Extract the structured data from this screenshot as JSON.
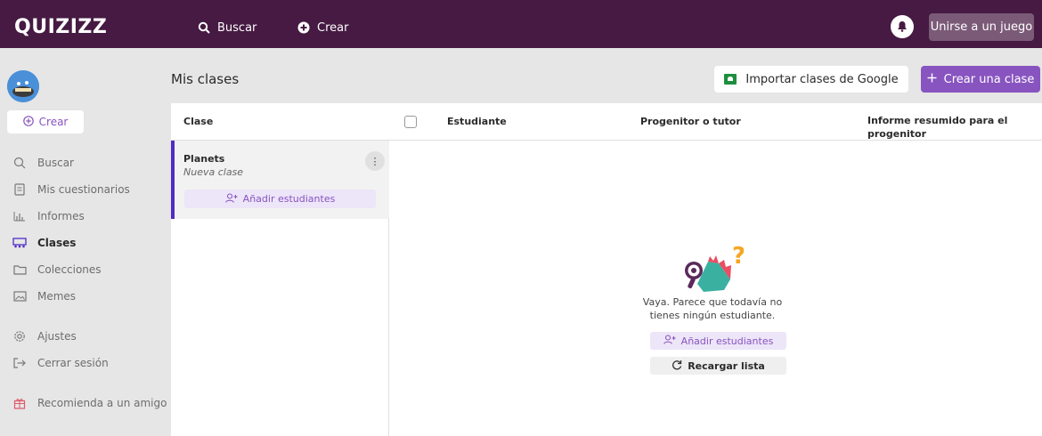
{
  "header": {
    "logo": "QUIZIZZ",
    "nav": [
      {
        "label": "Buscar",
        "icon": "search-icon"
      },
      {
        "label": "Crear",
        "icon": "plus-circle-icon"
      }
    ],
    "notifications_icon": "bell-icon",
    "join_button": "Unirse a un juego"
  },
  "sidebar": {
    "create_button": "Crear",
    "items": [
      {
        "label": "Buscar",
        "icon": "search-icon"
      },
      {
        "label": "Mis cuestionarios",
        "icon": "document-icon"
      },
      {
        "label": "Informes",
        "icon": "bar-chart-icon"
      },
      {
        "label": "Clases",
        "icon": "classroom-icon",
        "active": true
      },
      {
        "label": "Colecciones",
        "icon": "folder-icon"
      },
      {
        "label": "Memes",
        "icon": "image-icon"
      },
      {
        "label": "Ajustes",
        "icon": "gear-icon"
      },
      {
        "label": "Cerrar sesión",
        "icon": "logout-icon"
      },
      {
        "label": "Recomienda a un amigo",
        "icon": "gift-icon"
      }
    ]
  },
  "main": {
    "title": "Mis clases",
    "import_button": "Importar clases de Google",
    "create_class_button": "Crear una clase",
    "columns": {
      "class": "Clase",
      "student": "Estudiante",
      "parent": "Progenitor o tutor",
      "report_line1": "Informe resumido para el",
      "report_line2": "progenitor"
    },
    "classes": [
      {
        "name": "Planets",
        "subtitle": "Nueva clase",
        "add_students": "Añadir estudiantes"
      }
    ],
    "empty_state": {
      "line1": "Vaya. Parece que todavía no",
      "line2": "tienes ningún estudiante.",
      "add_students": "Añadir estudiantes",
      "reload": "Recargar lista"
    }
  },
  "colors": {
    "topbar": "#461a42",
    "accent": "#8854c0",
    "class_marker": "#4f2cc5"
  }
}
